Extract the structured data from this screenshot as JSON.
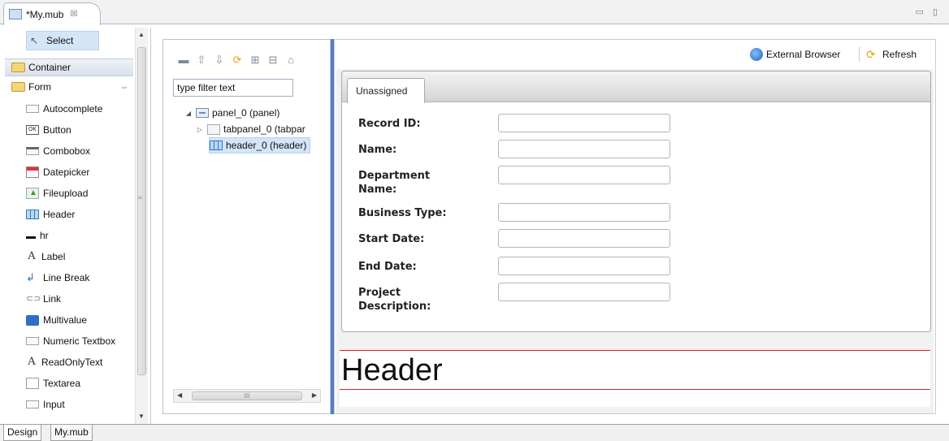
{
  "editor": {
    "tab_title": "*My.mub",
    "close_glyph": "☒",
    "window_controls": "▭ ▯"
  },
  "palette": {
    "select_label": "Select",
    "drawers": [
      {
        "label": "Container"
      },
      {
        "label": "Form",
        "pin": "⇔"
      }
    ],
    "items": [
      {
        "label": "Autocomplete",
        "icon": "autocomplete-icon"
      },
      {
        "label": "Button",
        "icon": "button-icon",
        "glyph": "OK"
      },
      {
        "label": "Combobox",
        "icon": "combobox-icon"
      },
      {
        "label": "Datepicker",
        "icon": "datepicker-icon"
      },
      {
        "label": "Fileupload",
        "icon": "fileupload-icon"
      },
      {
        "label": "Header",
        "icon": "header-icon"
      },
      {
        "label": "hr",
        "icon": "hr-icon"
      },
      {
        "label": "Label",
        "icon": "label-icon",
        "glyph": "A"
      },
      {
        "label": "Line Break",
        "icon": "line-break-icon",
        "glyph": "↲"
      },
      {
        "label": "Link",
        "icon": "link-icon",
        "glyph": "⊂⊃"
      },
      {
        "label": "Multivalue",
        "icon": "multivalue-icon"
      },
      {
        "label": "Numeric Textbox",
        "icon": "numeric-textbox-icon"
      },
      {
        "label": "ReadOnlyText",
        "icon": "readonlytext-icon",
        "glyph": "A"
      },
      {
        "label": "Textarea",
        "icon": "textarea-icon"
      },
      {
        "label": "Input",
        "icon": "input-icon"
      }
    ]
  },
  "outline": {
    "filter_placeholder": "type filter text",
    "filter_value": "type filter text",
    "toolbar_glyphs": [
      "▬",
      "⇧",
      "⇩",
      "⟳",
      "⊞",
      "⊟",
      "⌂"
    ],
    "tree": [
      {
        "label": "panel_0 (panel)",
        "twisty": "◢"
      },
      {
        "label": "tabpanel_0 (tabpar",
        "twisty": "▷"
      },
      {
        "label": "header_0 (header)",
        "twisty": ""
      }
    ],
    "hscroll_glyph": "III"
  },
  "preview": {
    "external_browser_label": "External Browser",
    "refresh_label": "Refresh",
    "refresh_glyph": "⟳",
    "tab_label": "Unassigned",
    "fields": [
      {
        "label": "Record ID:",
        "value": ""
      },
      {
        "label": "Name:",
        "value": ""
      },
      {
        "label": "Department Name:",
        "value": ""
      },
      {
        "label": "Business Type:",
        "value": ""
      },
      {
        "label": "Start Date:",
        "value": ""
      },
      {
        "label": "End Date:",
        "value": ""
      },
      {
        "label": "Project Description:",
        "value": ""
      }
    ],
    "header_text": "Header",
    "header_rule_color": "#e02020"
  },
  "bottom_tabs": [
    "Design",
    "My.mub"
  ],
  "colors": {
    "selection": "#d4e5f7",
    "splitter": "#5b7fc0"
  }
}
